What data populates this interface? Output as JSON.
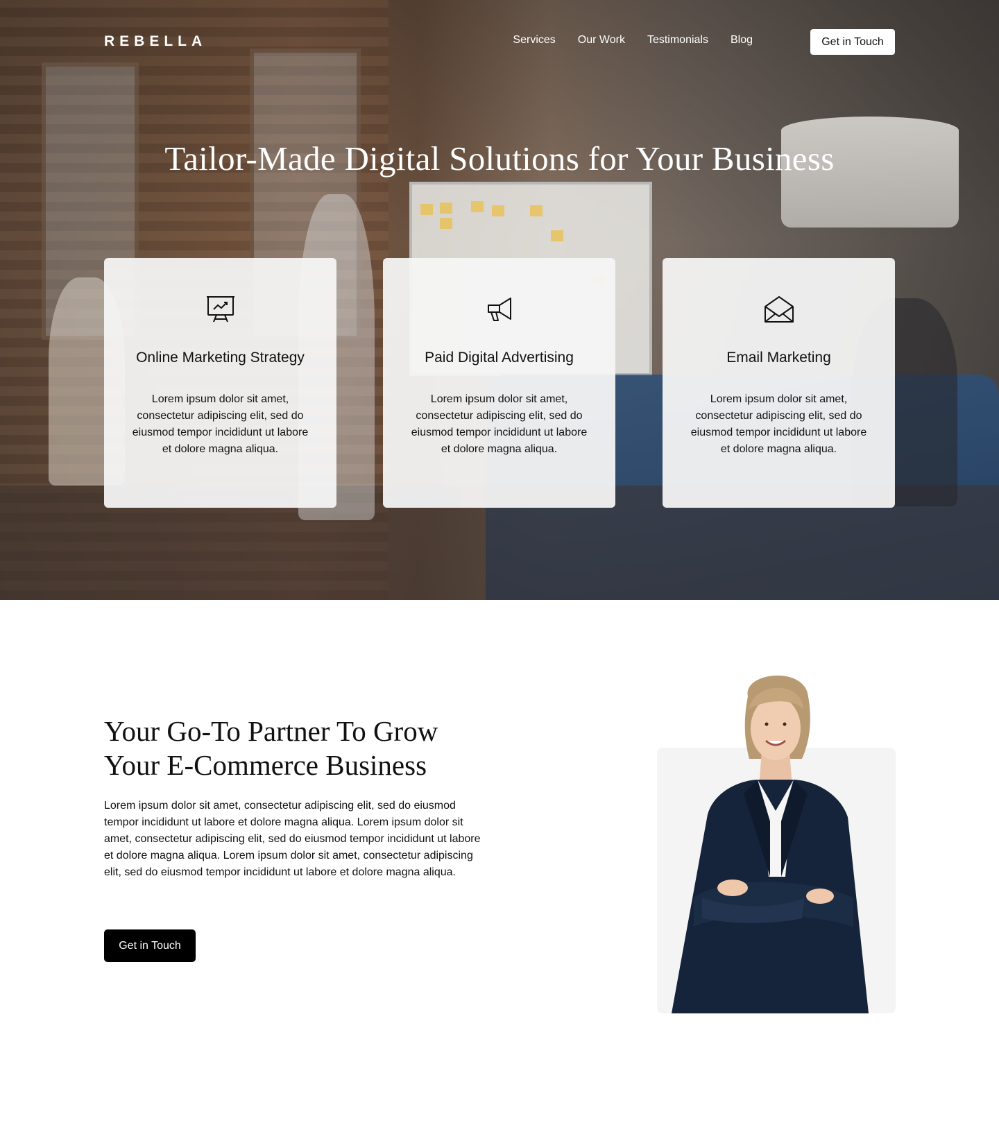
{
  "brand": {
    "logo": "REBELLA"
  },
  "nav": {
    "links": [
      "Services",
      "Our Work",
      "Testimonials",
      "Blog"
    ],
    "cta": "Get in Touch"
  },
  "hero": {
    "title": "Tailor-Made Digital Solutions for Your Business"
  },
  "services": [
    {
      "icon": "presentation-chart-icon",
      "title": "Online Marketing Strategy",
      "text": "Lorem ipsum dolor sit amet, consectetur adipiscing elit, sed do eiusmod tempor incididunt ut labore et dolore magna aliqua."
    },
    {
      "icon": "megaphone-icon",
      "title": "Paid Digital Advertising",
      "text": "Lorem ipsum dolor sit amet, consectetur adipiscing elit, sed do eiusmod tempor incididunt ut labore et dolore magna aliqua."
    },
    {
      "icon": "open-envelope-icon",
      "title": "Email Marketing",
      "text": "Lorem ipsum dolor sit amet, consectetur adipiscing elit, sed do eiusmod tempor incididunt ut labore et dolore magna aliqua."
    }
  ],
  "partner": {
    "title": "Your Go-To Partner To Grow Your E-Commerce Business",
    "text": "Lorem ipsum dolor sit amet, consectetur adipiscing elit, sed do eiusmod tempor incididunt ut labore et dolore magna aliqua. Lorem ipsum dolor sit amet, consectetur adipiscing elit, sed do eiusmod tempor incididunt ut labore et dolore magna aliqua. Lorem ipsum dolor sit amet, consectetur adipiscing elit, sed do eiusmod tempor incididunt ut labore et dolore magna aliqua.",
    "cta": "Get in Touch"
  },
  "colors": {
    "primary_button": "#000000",
    "card_background": "#f5f5f5",
    "text": "#111111"
  }
}
